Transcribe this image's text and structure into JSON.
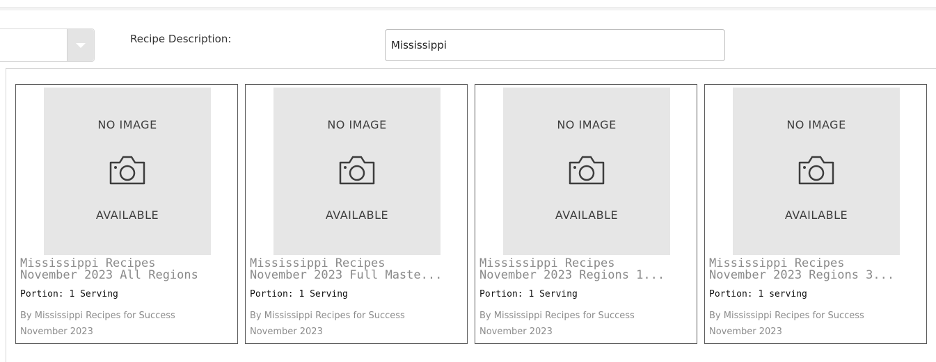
{
  "filters": {
    "description_label": "Recipe Description:",
    "description_value": "Mississippi"
  },
  "placeholder_image": {
    "top_text": "NO IMAGE",
    "bottom_text": "AVAILABLE",
    "icon": "camera-icon"
  },
  "recipes": [
    {
      "title_line1": "Mississippi Recipes",
      "title_line2": "November 2023 All Regions",
      "portion": "Portion: 1 Serving",
      "author": "By Mississippi Recipes for Success",
      "date": "November 2023"
    },
    {
      "title_line1": "Mississippi Recipes",
      "title_line2": "November 2023 Full Maste...",
      "portion": "Portion: 1 Serving",
      "author": "By Mississippi Recipes for Success",
      "date": "November 2023"
    },
    {
      "title_line1": "Mississippi Recipes",
      "title_line2": "November 2023 Regions 1...",
      "portion": "Portion: 1 Serving",
      "author": "By Mississippi Recipes for Success",
      "date": "November 2023"
    },
    {
      "title_line1": "Mississippi Recipes",
      "title_line2": "November 2023 Regions 3...",
      "portion": "Portion: 1 serving",
      "author": "By Mississippi Recipes for Success",
      "date": "November 2023"
    }
  ]
}
